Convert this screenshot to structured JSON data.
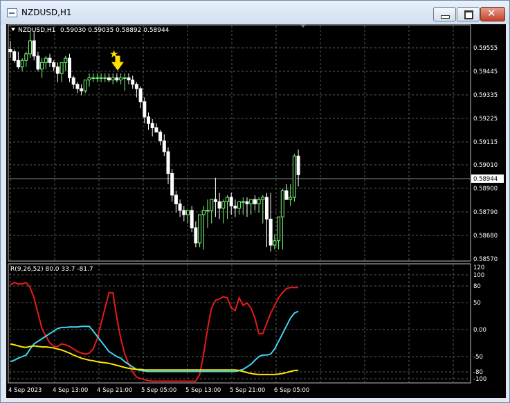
{
  "window": {
    "title": "NZDUSD,H1",
    "icon": "chart-window-icon",
    "controls": [
      "minimize-icon",
      "maximize-icon",
      "close-icon"
    ]
  },
  "colors": {
    "background": "#000000",
    "grid": "#5a5a5a",
    "bull_candle": "#7dff7a",
    "bear_candle": "#ffffff",
    "price_line": "#8a8a8a",
    "signal": "#ffe000",
    "red_line": "#e81a1a",
    "cyan_line": "#3ed6f4",
    "yellow_line": "#ffe400"
  },
  "chart": {
    "symbol_header": "NZDUSD,H1",
    "ohlc_header": "0.59030 0.59035 0.58892 0.58944",
    "current_price": "0.58944",
    "price_scale": [
      "0.59555",
      "0.59445",
      "0.59335",
      "0.59225",
      "0.59115",
      "0.59010",
      "0.58900",
      "0.58790",
      "0.58680",
      "0.58570"
    ],
    "signal_icons": [
      "star-icon",
      "down-arrow-icon"
    ]
  },
  "indicator": {
    "header": "R(9,26,52) 80.0 33.7 -81.7",
    "scale": [
      "120",
      "100",
      "80",
      "50",
      "0.00",
      "-50",
      "-80",
      "-100"
    ]
  },
  "time_axis": [
    "4 Sep 2023",
    "4 Sep 13:00",
    "4 Sep 21:00",
    "5 Sep 05:00",
    "5 Sep 13:00",
    "5 Sep 21:00",
    "6 Sep 05:00"
  ],
  "chart_data": [
    {
      "type": "candlestick",
      "title": "NZDUSD,H1",
      "x": [
        "4 Sep 2023",
        "",
        "",
        "",
        "",
        "",
        "",
        "",
        "",
        "",
        "",
        "",
        "",
        "",
        "",
        "",
        "",
        "",
        "",
        "",
        "",
        "",
        "",
        "",
        "",
        "",
        "",
        "",
        "",
        "",
        "",
        "",
        "",
        "",
        "",
        "",
        "",
        "",
        "",
        "",
        "",
        "",
        "",
        "",
        "",
        "",
        "",
        "",
        "",
        "",
        "",
        "",
        "",
        "",
        "",
        "",
        "",
        "",
        "",
        "",
        "",
        "",
        "",
        "",
        "",
        "",
        "",
        "",
        "",
        "",
        "",
        "",
        "",
        "6 Sep 05:00"
      ],
      "open": [
        0.5952,
        0.5951,
        0.5947,
        0.5944,
        0.5947,
        0.595,
        0.5956,
        0.5949,
        0.5943,
        0.5946,
        0.5948,
        0.5946,
        0.5944,
        0.5941,
        0.5946,
        0.5948,
        0.5939,
        0.5936,
        0.5934,
        0.5933,
        0.5938,
        0.5939,
        0.5939,
        0.5939,
        0.5939,
        0.5939,
        0.5938,
        0.5939,
        0.5938,
        0.5939,
        0.5939,
        0.5938,
        0.5936,
        0.5934,
        0.5928,
        0.5921,
        0.5918,
        0.5916,
        0.5914,
        0.591,
        0.5905,
        0.5895,
        0.5885,
        0.5881,
        0.5878,
        0.5876,
        0.5878,
        0.587,
        0.5863,
        0.5876,
        0.5878,
        0.5878,
        0.5883,
        0.5882,
        0.5879,
        0.5882,
        0.5884,
        0.588,
        0.5879,
        0.5882,
        0.5882,
        0.5881,
        0.5883,
        0.5881,
        0.5883,
        0.5884,
        0.5874,
        0.5862,
        0.5864,
        0.5875,
        0.5887,
        0.5883,
        0.5884,
        0.5903
      ],
      "high": [
        0.5956,
        0.5952,
        0.5951,
        0.5948,
        0.5951,
        0.596,
        0.596,
        0.5951,
        0.5948,
        0.5949,
        0.595,
        0.5947,
        0.5946,
        0.5945,
        0.5949,
        0.595,
        0.594,
        0.5937,
        0.5936,
        0.5937,
        0.5941,
        0.5941,
        0.5941,
        0.5941,
        0.5941,
        0.5941,
        0.5941,
        0.5941,
        0.5941,
        0.5941,
        0.5941,
        0.594,
        0.5937,
        0.5935,
        0.593,
        0.5923,
        0.592,
        0.5918,
        0.5915,
        0.5913,
        0.5907,
        0.5897,
        0.5887,
        0.5883,
        0.588,
        0.5878,
        0.588,
        0.5873,
        0.5867,
        0.588,
        0.5883,
        0.5881,
        0.5893,
        0.5886,
        0.5883,
        0.5885,
        0.5886,
        0.5883,
        0.5882,
        0.5884,
        0.5884,
        0.5883,
        0.5885,
        0.5884,
        0.5885,
        0.5886,
        0.5886,
        0.5867,
        0.5866,
        0.5888,
        0.589,
        0.589,
        0.5904,
        0.5906
      ],
      "low": [
        0.5948,
        0.5946,
        0.5943,
        0.5942,
        0.5944,
        0.5948,
        0.5947,
        0.5942,
        0.5939,
        0.5943,
        0.5944,
        0.5942,
        0.5937,
        0.5937,
        0.5942,
        0.5937,
        0.5934,
        0.5932,
        0.5931,
        0.5932,
        0.5935,
        0.5937,
        0.5937,
        0.5937,
        0.5937,
        0.5937,
        0.5936,
        0.5937,
        0.5936,
        0.5933,
        0.5936,
        0.5934,
        0.593,
        0.5925,
        0.5918,
        0.5915,
        0.5912,
        0.5914,
        0.5908,
        0.5903,
        0.589,
        0.5882,
        0.5877,
        0.5875,
        0.5873,
        0.5872,
        0.5868,
        0.5861,
        0.5861,
        0.586,
        0.587,
        0.5872,
        0.5875,
        0.5874,
        0.5872,
        0.5874,
        0.5876,
        0.5875,
        0.5876,
        0.5876,
        0.5875,
        0.5876,
        0.5878,
        0.5877,
        0.5872,
        0.5861,
        0.5859,
        0.586,
        0.586,
        0.586,
        0.5884,
        0.588,
        0.5882,
        0.5889
      ],
      "close": [
        0.5951,
        0.5947,
        0.5944,
        0.5947,
        0.595,
        0.5956,
        0.5949,
        0.5943,
        0.5946,
        0.5948,
        0.5946,
        0.5944,
        0.5941,
        0.5946,
        0.5948,
        0.5939,
        0.5936,
        0.5934,
        0.5933,
        0.5938,
        0.5939,
        0.5939,
        0.5939,
        0.5939,
        0.5939,
        0.5938,
        0.5939,
        0.5938,
        0.5939,
        0.5939,
        0.5938,
        0.5936,
        0.5934,
        0.5928,
        0.5921,
        0.5918,
        0.5916,
        0.5914,
        0.591,
        0.5905,
        0.5895,
        0.5885,
        0.5881,
        0.5878,
        0.5876,
        0.5878,
        0.587,
        0.5863,
        0.5876,
        0.5878,
        0.5878,
        0.5883,
        0.5882,
        0.5879,
        0.5882,
        0.5884,
        0.588,
        0.5879,
        0.5882,
        0.5882,
        0.5881,
        0.5883,
        0.5881,
        0.5883,
        0.5884,
        0.5874,
        0.5862,
        0.5864,
        0.5875,
        0.5887,
        0.5883,
        0.5884,
        0.5903,
        0.58944
      ],
      "ylim": [
        0.5855,
        0.5963
      ],
      "signal_bar_index": 29,
      "grid": true,
      "legend": "none"
    },
    {
      "type": "line",
      "title": "R(9,26,52)",
      "xlabel": "",
      "ylabel": "",
      "ylim": [
        -105,
        125
      ],
      "x_count": 74,
      "series": [
        {
          "values": [
            85,
            90,
            87,
            87,
            90,
            80,
            60,
            30,
            0,
            -15,
            -28,
            -35,
            -35,
            -30,
            -32,
            -35,
            -40,
            -45,
            -48,
            -50,
            -48,
            -40,
            -20,
            10,
            40,
            70,
            70,
            20,
            -20,
            -50,
            -70,
            -85,
            -95,
            -98,
            -100,
            -102,
            -103,
            -103,
            -103,
            -103,
            -103,
            -103,
            -103,
            -103,
            -103,
            -103,
            -103,
            -103,
            -90,
            -50,
            0,
            40,
            55,
            58,
            62,
            60,
            40,
            35,
            60,
            45,
            50,
            40,
            20,
            -10,
            -10,
            10,
            30,
            45,
            60,
            70,
            78,
            80,
            80,
            80
          ]
        },
        {
          "values": [
            -65,
            -62,
            -58,
            -55,
            -52,
            -40,
            -30,
            -25,
            -20,
            -15,
            -10,
            -5,
            0,
            2,
            2,
            3,
            3,
            3,
            4,
            4,
            4,
            -5,
            -15,
            -25,
            -35,
            -45,
            -50,
            -55,
            -58,
            -65,
            -70,
            -75,
            -80,
            -82,
            -83,
            -84,
            -84,
            -84,
            -84,
            -84,
            -84,
            -84,
            -84,
            -84,
            -84,
            -84,
            -84,
            -84,
            -84,
            -84,
            -84,
            -84,
            -84,
            -84,
            -84,
            -84,
            -84,
            -84,
            -82,
            -80,
            -75,
            -70,
            -62,
            -55,
            -52,
            -52,
            -50,
            -40,
            -25,
            -10,
            5,
            20,
            30,
            33.7
          ]
        },
        {
          "values": [
            -30,
            -32,
            -34,
            -36,
            -37,
            -35,
            -34,
            -35,
            -36,
            -36,
            -37,
            -38,
            -40,
            -42,
            -45,
            -48,
            -52,
            -55,
            -58,
            -60,
            -62,
            -63,
            -65,
            -66,
            -67,
            -68,
            -70,
            -72,
            -74,
            -76,
            -78,
            -79,
            -80,
            -80,
            -81,
            -81,
            -81,
            -81,
            -81,
            -81,
            -81,
            -81,
            -81,
            -81,
            -81,
            -81,
            -81,
            -81,
            -81,
            -81,
            -81,
            -81,
            -81,
            -81,
            -81,
            -81,
            -81,
            -81,
            -82,
            -84,
            -86,
            -88,
            -89,
            -90,
            -90,
            -90,
            -90,
            -90,
            -89,
            -88,
            -86,
            -84,
            -82,
            -81.7
          ]
        }
      ]
    }
  ]
}
